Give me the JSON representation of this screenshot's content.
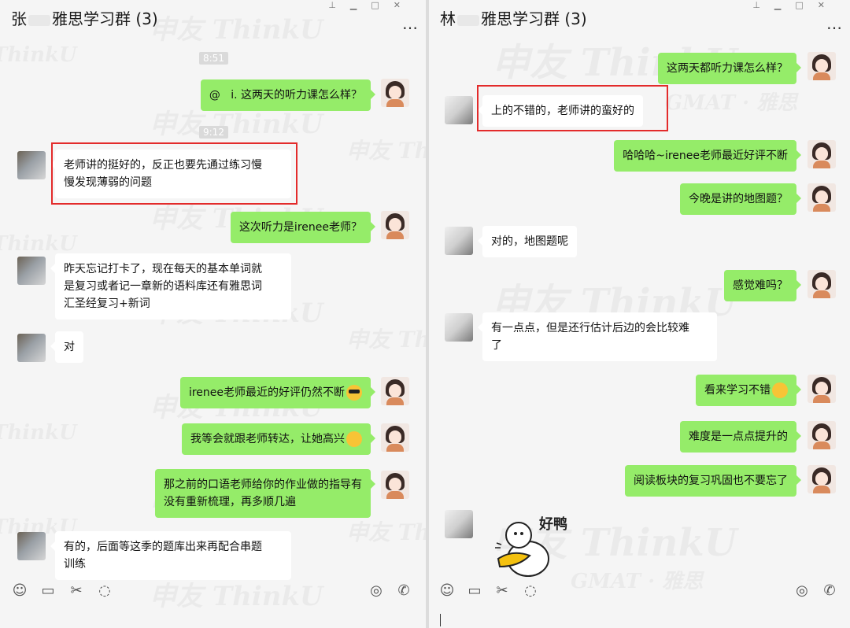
{
  "left": {
    "title_prefix": "张",
    "title_suffix": "雅思学习群 (3)",
    "timestamps": [
      "8:51",
      "9:12"
    ],
    "messages": [
      {
        "dir": "out",
        "text": "@   i. 这两天的听力课怎么样？"
      },
      {
        "dir": "in",
        "text": "老师讲的挺好的，反正也要先通过练习慢\n慢发现薄弱的问题"
      },
      {
        "dir": "out",
        "text": "这次听力是irenee老师？"
      },
      {
        "dir": "in",
        "text": "昨天忘记打卡了，现在每天的基本单词就\n是复习或者记一章新的语料库还有雅思词\n汇圣经复习+新词"
      },
      {
        "dir": "in",
        "text": "对"
      },
      {
        "dir": "out",
        "text": "irenee老师最近的好评仍然不断",
        "emoji": "sunglasses-emoji"
      },
      {
        "dir": "out",
        "text": "我等会就跟老师转达，让她高兴",
        "emoji": "smile-emoji"
      },
      {
        "dir": "out",
        "text": "那之前的口语老师给你的作业做的指导有\n没有重新梳理，再多顺几遍"
      },
      {
        "dir": "in",
        "text": "有的，后面等这季的题库出来再配合串题\n训练"
      }
    ]
  },
  "right": {
    "title_prefix": "林",
    "title_suffix": "雅思学习群 (3)",
    "messages": [
      {
        "dir": "out",
        "text": "这两天都听力课怎么样？"
      },
      {
        "dir": "in",
        "text": "上的不错的，老师讲的蛮好的"
      },
      {
        "dir": "out",
        "text": "哈哈哈~irenee老师最近好评不断"
      },
      {
        "dir": "out",
        "text": "今晚是讲的地图题？"
      },
      {
        "dir": "in",
        "text": "对的，地图题呢"
      },
      {
        "dir": "out",
        "text": "感觉难吗？"
      },
      {
        "dir": "in",
        "text": "有一点点，但是还行估计后边的会比较难\n了"
      },
      {
        "dir": "out",
        "text": "看来学习不错",
        "emoji": "thumbs-emoji"
      },
      {
        "dir": "out",
        "text": "难度是一点点提升的"
      },
      {
        "dir": "out",
        "text": "阅读板块的复习巩固也不要忘了"
      }
    ],
    "sticker_text": "好鸭"
  },
  "watermark": {
    "brand": "ThinkU",
    "cn": "申友",
    "sub": "GMAT · 雅思"
  },
  "window_controls": [
    "pin",
    "minimize",
    "maximize",
    "close"
  ],
  "toolbar_icons": [
    "emoji-icon",
    "folder-icon",
    "scissors-icon",
    "chat-history-icon",
    "video-call-icon",
    "voice-call-icon"
  ],
  "colors": {
    "outgoing_bubble": "#95ec69",
    "incoming_bubble": "#ffffff",
    "highlight": "#e32b2b",
    "background": "#f5f5f5"
  }
}
